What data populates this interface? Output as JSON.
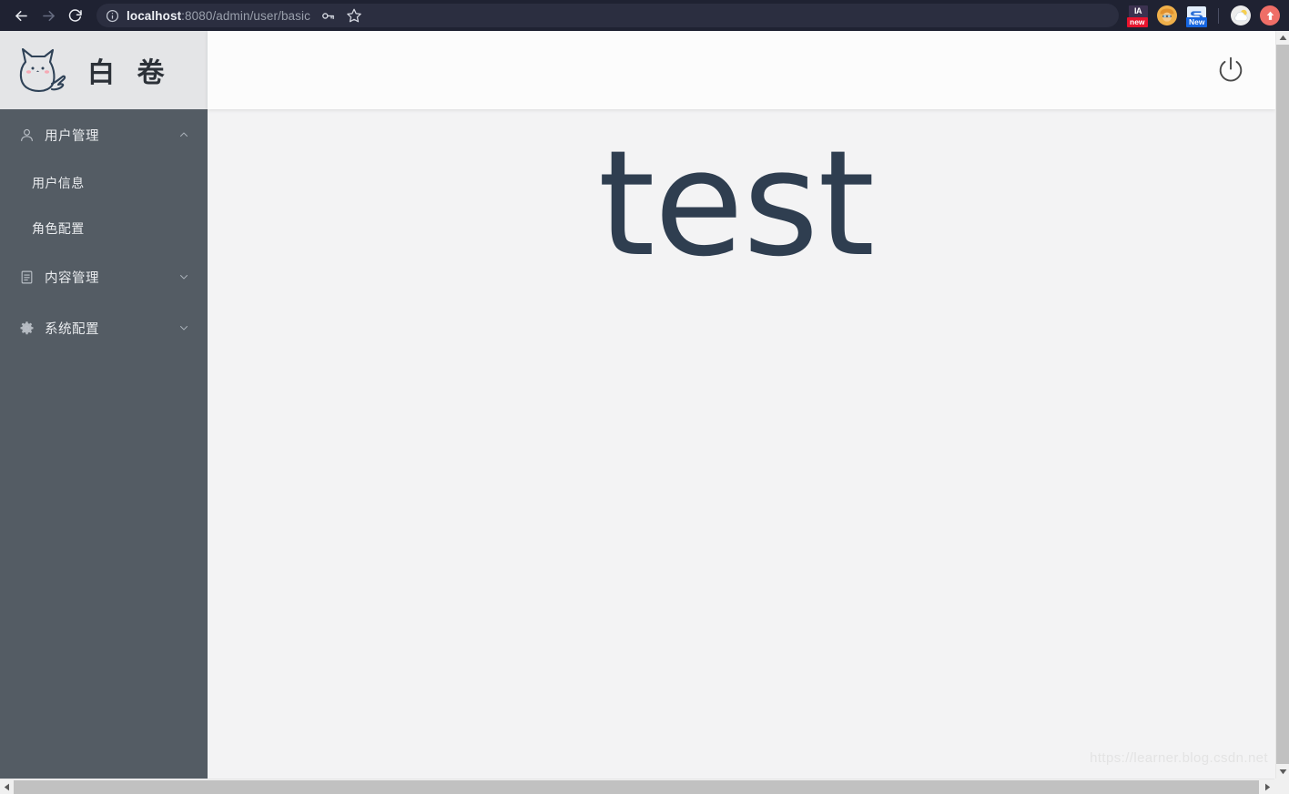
{
  "browser": {
    "back_icon": "back-arrow-icon",
    "forward_icon": "forward-arrow-icon",
    "reload_icon": "reload-icon",
    "info_icon": "site-info-icon",
    "url_host": "localhost",
    "url_rest": ":8080/admin/user/basic",
    "url_full": "localhost:8080/admin/user/basic",
    "actions": [
      {
        "name": "password-key-icon",
        "glyph": "key"
      },
      {
        "name": "bookmark-star-icon",
        "glyph": "star"
      }
    ],
    "extensions": [
      {
        "name": "ia-extension-icon",
        "label": "IA",
        "badge": "new",
        "badge_color": "#e8142d"
      },
      {
        "name": "avatar-extension-icon",
        "label": "",
        "badge": "",
        "badge_color": ""
      },
      {
        "name": "s-extension-icon",
        "label": "S",
        "badge": "New",
        "badge_color": "#1565e0"
      }
    ],
    "profile": [
      {
        "name": "weather-extension-icon"
      },
      {
        "name": "upload-arrow-icon"
      }
    ]
  },
  "app": {
    "logo_icon": "cat-logo-icon",
    "title": "白 卷",
    "header": {
      "logout_icon": "power-logout-icon"
    }
  },
  "sidebar": {
    "groups": [
      {
        "id": "user-management",
        "label": "用户管理",
        "icon": "user-icon",
        "expanded": true,
        "chevron": "chevron-up-icon",
        "items": [
          {
            "id": "user-basic",
            "label": "用户信息"
          },
          {
            "id": "role-config",
            "label": "角色配置"
          }
        ]
      },
      {
        "id": "content-management",
        "label": "内容管理",
        "icon": "document-icon",
        "expanded": false,
        "chevron": "chevron-down-icon",
        "items": []
      },
      {
        "id": "system-config",
        "label": "系统配置",
        "icon": "gear-icon",
        "expanded": false,
        "chevron": "chevron-down-icon",
        "items": []
      }
    ]
  },
  "main": {
    "heading": "test",
    "watermark": "https://learner.blog.csdn.net"
  },
  "colors": {
    "sidebar_bg": "#545c64",
    "logo_bg": "#e4e5e7",
    "header_bg": "#fcfcfc",
    "content_bg": "#f3f3f4",
    "heading_color": "#2f3e50",
    "chrome_bg": "#1f2232",
    "omnibox_bg": "#2b2e40"
  },
  "scrollbars": {
    "vertical_up": "scroll-up-arrow",
    "vertical_down": "scroll-down-arrow",
    "horizontal_left": "scroll-left-arrow",
    "horizontal_right": "scroll-right-arrow"
  }
}
